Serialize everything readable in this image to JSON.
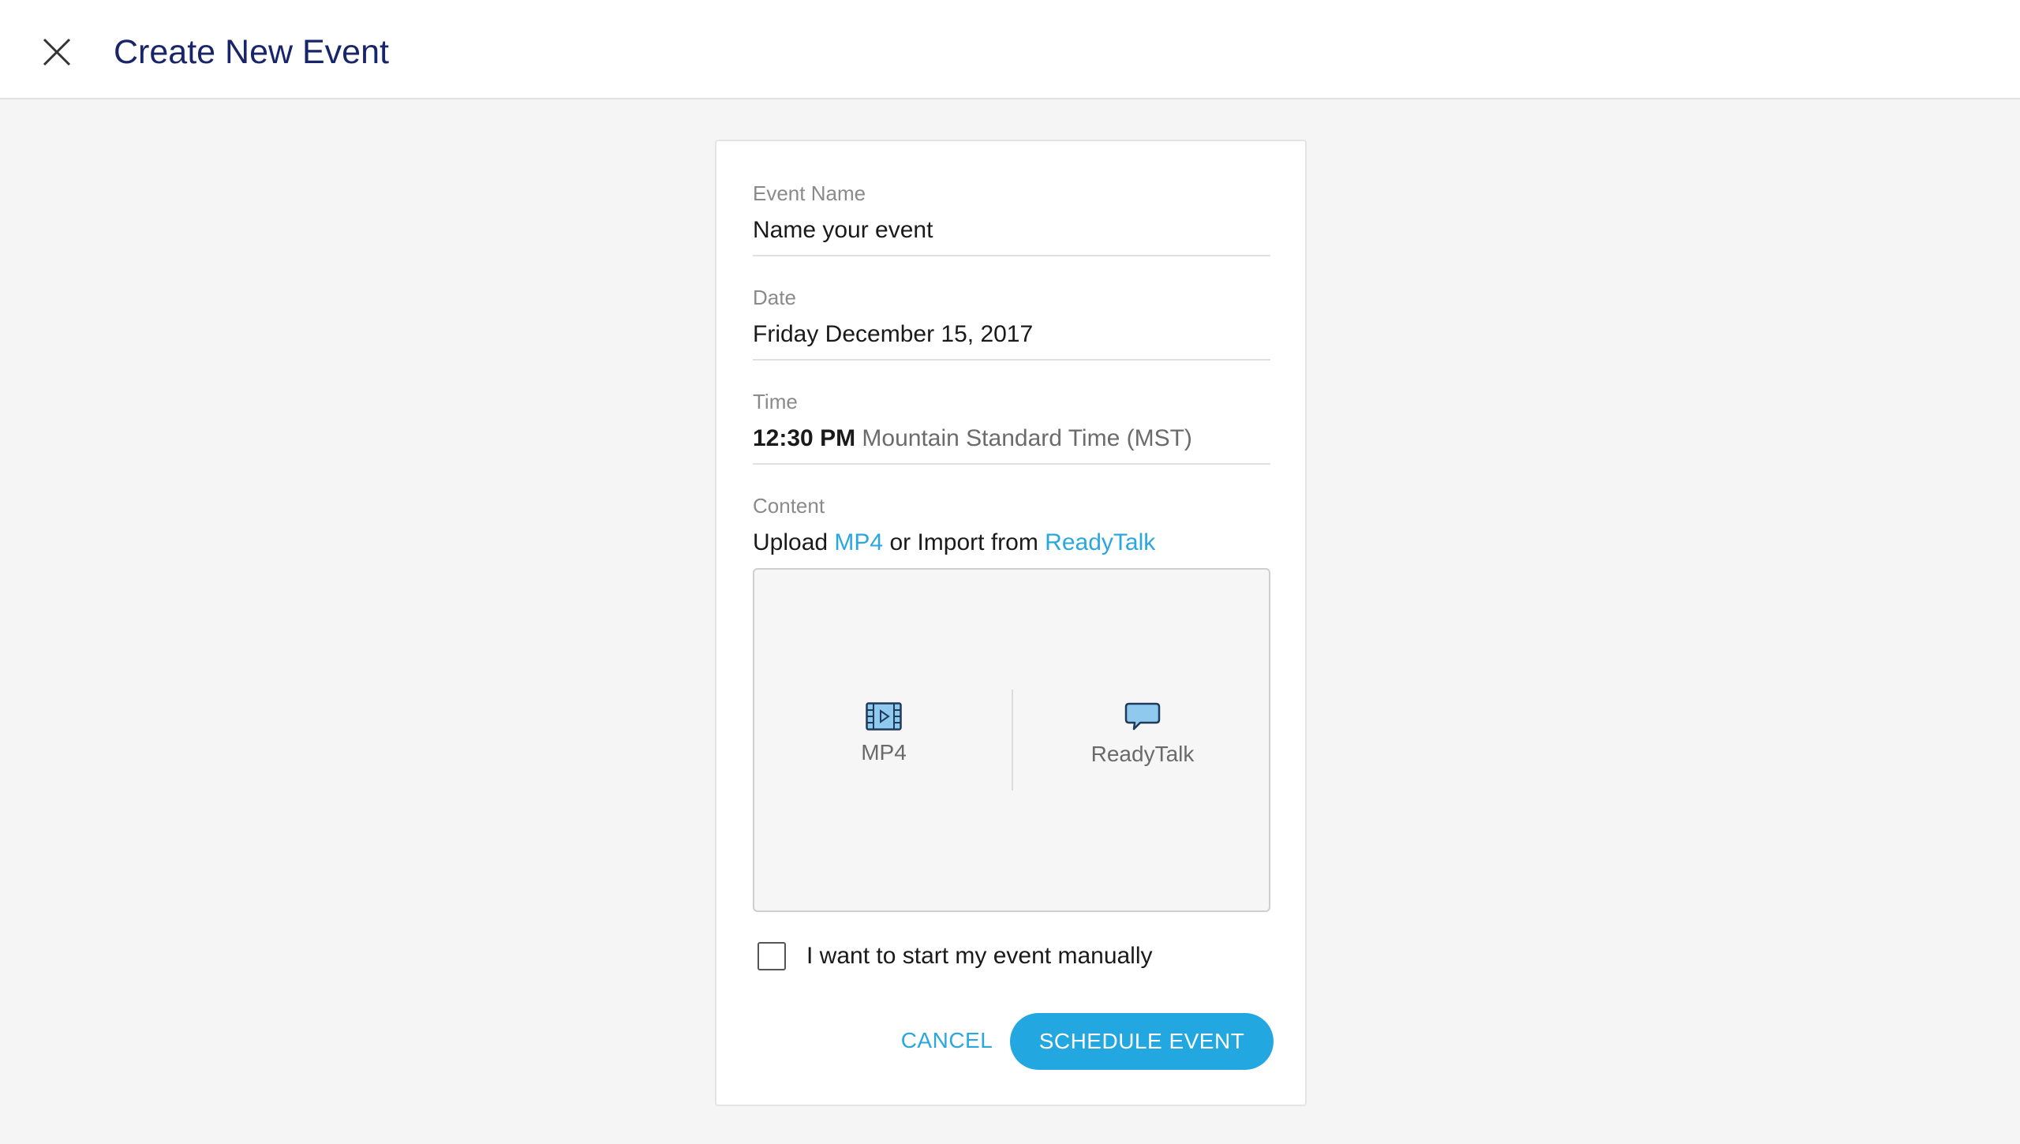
{
  "header": {
    "title": "Create New Event",
    "close_icon": "close-icon"
  },
  "form": {
    "event_name": {
      "label": "Event Name",
      "value": "Name your event"
    },
    "date": {
      "label": "Date",
      "value": "Friday December 15, 2017"
    },
    "time": {
      "label": "Time",
      "value": "12:30 PM",
      "timezone": "Mountain Standard Time (MST)"
    },
    "content": {
      "label": "Content",
      "prefix": "Upload",
      "mp4_link": "MP4",
      "middle": "or Import from",
      "readytalk_link": "ReadyTalk",
      "options": [
        {
          "label": "MP4",
          "icon": "film-icon"
        },
        {
          "label": "ReadyTalk",
          "icon": "speech-bubble-icon"
        }
      ]
    },
    "manual_start": {
      "label": "I want to start my event manually",
      "checked": false
    }
  },
  "actions": {
    "cancel_label": "CANCEL",
    "schedule_label": "SCHEDULE EVENT"
  },
  "colors": {
    "title": "#18256a",
    "accent": "#22a7e0",
    "link": "#2aa7de"
  }
}
